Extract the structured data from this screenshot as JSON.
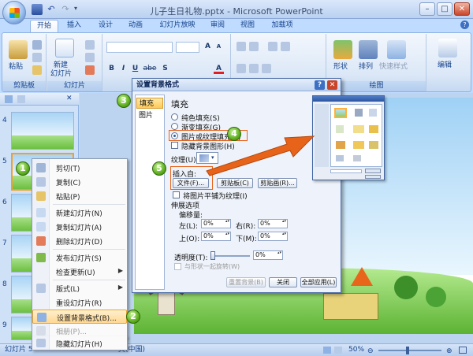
{
  "window": {
    "title": "儿子生日礼物.pptx - Microsoft PowerPoint",
    "minimize": "–",
    "maximize": "□",
    "close": "✕"
  },
  "quick_access": [
    "save-icon",
    "undo-icon",
    "redo-icon"
  ],
  "tabs": [
    {
      "label": "开始",
      "active": true
    },
    {
      "label": "插入"
    },
    {
      "label": "设计"
    },
    {
      "label": "动画"
    },
    {
      "label": "幻灯片放映"
    },
    {
      "label": "审阅"
    },
    {
      "label": "视图"
    },
    {
      "label": "加载项"
    }
  ],
  "ribbon": {
    "paste": "粘贴",
    "clipboard": "剪贴板",
    "new_slide_line1": "新建",
    "new_slide_line2": "幻灯片",
    "slides": "幻灯片",
    "shapes": "形状",
    "arrange": "排列",
    "quick_styles": "快速样式",
    "drawing": "绘图",
    "edit": "编辑",
    "bold": "B",
    "italic": "I",
    "underline": "U",
    "strike": "abe",
    "shadow": "S",
    "font_size_up": "A",
    "font_size_down": "A",
    "font_color": "A"
  },
  "slide_panel": {
    "numbers": [
      "4",
      "5",
      "6",
      "7",
      "8",
      "9"
    ]
  },
  "status": {
    "slide_label": "幻灯片 5",
    "language": "文(中国)",
    "zoom": "50%"
  },
  "context_menu": {
    "items": [
      {
        "label": "剪切(T)",
        "icon": "cut-icon"
      },
      {
        "label": "复制(C)",
        "icon": "copy-icon"
      },
      {
        "label": "粘贴(P)",
        "icon": "paste-icon"
      },
      {
        "label": "新建幻灯片(N)",
        "icon": "new-slide-icon"
      },
      {
        "label": "复制幻灯片(A)",
        "icon": "duplicate-slide-icon"
      },
      {
        "label": "删除幻灯片(D)",
        "icon": "delete-slide-icon"
      },
      {
        "label": "发布幻灯片(S)",
        "icon": "publish-slide-icon"
      },
      {
        "label": "检查更新(U)",
        "icon": "check-updates-icon"
      },
      {
        "label": "版式(L)",
        "icon": "layout-icon"
      },
      {
        "label": "重设幻灯片(R)",
        "icon": "reset-slide-icon"
      },
      {
        "label": "设置背景格式(B)...",
        "icon": "format-background-icon"
      },
      {
        "label": "相册(P)...",
        "icon": "photo-album-icon"
      },
      {
        "label": "隐藏幻灯片(H)",
        "icon": "hide-slide-icon"
      }
    ]
  },
  "dialog": {
    "title": "设置背景格式",
    "help": "?",
    "close": "✕",
    "nav": [
      "填充",
      "图片"
    ],
    "section_title": "填充",
    "fill_options": [
      {
        "label": "纯色填充(S)",
        "selected": false
      },
      {
        "label": "渐变填充(G)",
        "selected": false
      },
      {
        "label": "图片或纹理填充(P)",
        "selected": true
      }
    ],
    "hide_bg_graphics": "隐藏背景图形(H)",
    "texture_label": "纹理(U):",
    "insert_from_label": "插入自:",
    "file_button": "文件(F)...",
    "clipboard_button": "剪贴板(C)",
    "clipart_button": "剪贴画(R)...",
    "tile_checkbox": "将图片平铺为纹理(I)",
    "stretch_options": "伸展选项",
    "offsets_label": "偏移量:",
    "left_label": "左(L):",
    "right_label": "右(R):",
    "top_label": "上(O):",
    "bottom_label": "下(M):",
    "left_value": "0%",
    "right_value": "0%",
    "top_value": "0%",
    "bottom_value": "0%",
    "transparency_label": "透明度(T):",
    "transparency_value": "0%",
    "rotate_with_shape": "与形状一起旋转(W)",
    "reset_button": "重置背景(B)",
    "close_button": "关闭",
    "apply_all_button": "全部应用(L)"
  },
  "badges": [
    "1",
    "2",
    "3",
    "4",
    "5"
  ],
  "colors": {
    "accent_orange": "#e8631a",
    "badge_green": "#5fae20",
    "ribbon_blue": "#bfdbff"
  }
}
